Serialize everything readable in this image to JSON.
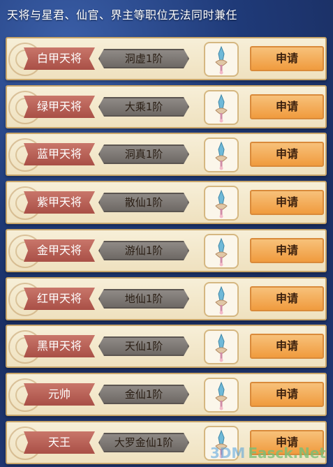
{
  "notice": "天将与星君、仙官、界主等职位无法同时兼任",
  "apply_label": "申请",
  "rows": [
    {
      "title": "白甲天将",
      "rank": "洞虚1阶"
    },
    {
      "title": "绿甲天将",
      "rank": "大乘1阶"
    },
    {
      "title": "蓝甲天将",
      "rank": "洞真1阶"
    },
    {
      "title": "紫甲天将",
      "rank": "散仙1阶"
    },
    {
      "title": "金甲天将",
      "rank": "游仙1阶"
    },
    {
      "title": "红甲天将",
      "rank": "地仙1阶"
    },
    {
      "title": "黑甲天将",
      "rank": "天仙1阶"
    },
    {
      "title": "元帅",
      "rank": "金仙1阶"
    },
    {
      "title": "天王",
      "rank": "大罗金仙1阶"
    }
  ],
  "icon": "sword-artifact-icon",
  "watermark": {
    "left": "3DM",
    "right": "Easck.Net"
  }
}
